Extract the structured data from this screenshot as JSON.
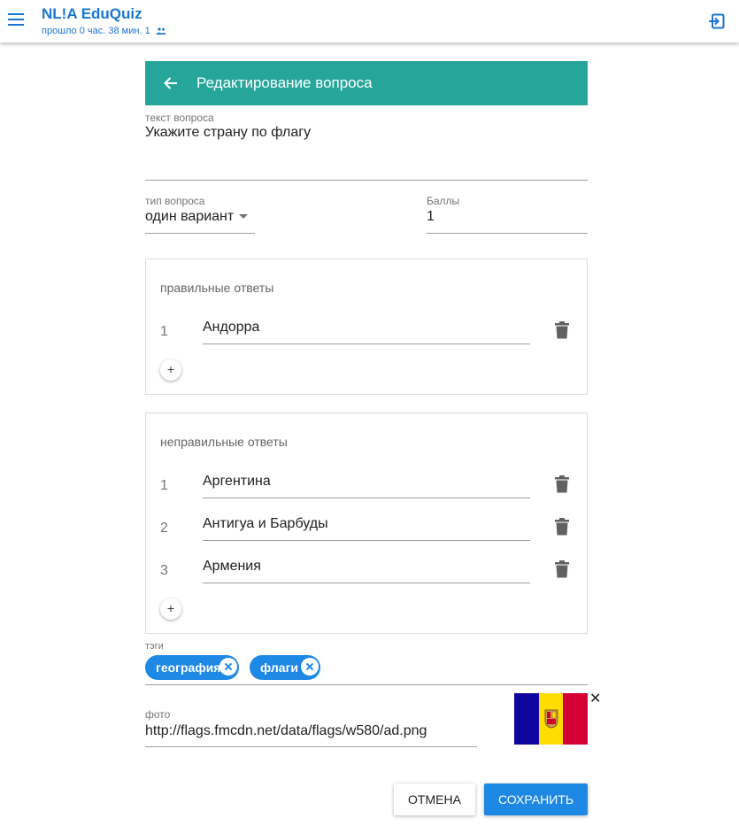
{
  "app": {
    "title": "NL!A EduQuiz",
    "subtitle": "прошло 0 час. 38 мин.",
    "participants": "1"
  },
  "card": {
    "title": "Редактирование вопроса"
  },
  "question": {
    "label": "текст вопроса",
    "value": "Укажите страну по флагу"
  },
  "type": {
    "label": "тип вопроса",
    "value": "один вариант"
  },
  "points": {
    "label": "Баллы",
    "value": "1"
  },
  "correct": {
    "title": "правильные ответы",
    "items": [
      {
        "num": "1",
        "value": "Андорра"
      }
    ],
    "add_label": "+"
  },
  "wrong": {
    "title": "неправильные ответы",
    "items": [
      {
        "num": "1",
        "value": "Аргентина"
      },
      {
        "num": "2",
        "value": "Антигуа и Барбуды"
      },
      {
        "num": "3",
        "value": "Армения"
      }
    ],
    "add_label": "+"
  },
  "tags": {
    "label": "тэги",
    "items": [
      "география",
      "флаги"
    ]
  },
  "photo": {
    "label": "фото",
    "value": "http://flags.fmcdn.net/data/flags/w580/ad.png",
    "close": "✕",
    "flag_colors": [
      "#10069f",
      "#fedd00",
      "#d50032"
    ]
  },
  "buttons": {
    "cancel": "ОТМЕНА",
    "save": "СОХРАНИТЬ"
  },
  "colors": {
    "accent": "#1976d2",
    "header": "#26a69a",
    "primary_button": "#1e88e5"
  }
}
